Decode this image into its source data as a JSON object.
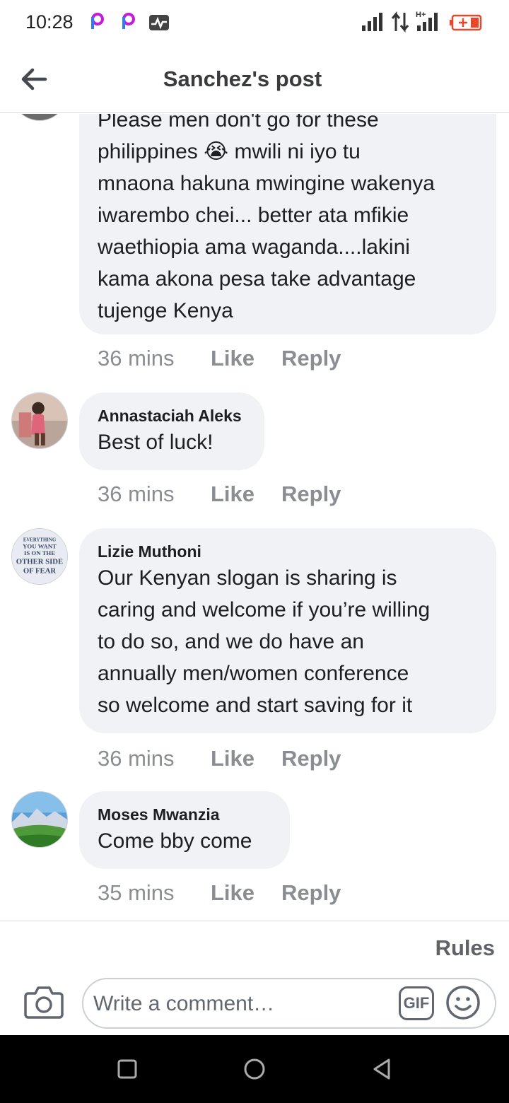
{
  "status_bar": {
    "time": "10:28",
    "icons": [
      "picsart-icon",
      "picsart-icon",
      "activity-icon",
      "signal-icon",
      "data-arrows-icon",
      "signal-hplus-icon",
      "battery-charging-icon"
    ],
    "network_label": "H+",
    "battery_color": "#e8472b"
  },
  "header": {
    "title": "Sanchez's post",
    "back_icon": "back-arrow-icon"
  },
  "comments": [
    {
      "name": "",
      "text": "Please men don't go for these\nphilippines 😭 mwili ni iyo tu\nmnaona hakuna mwingine wakenya\niwarembo chei... better ata mfikie\nwaethiopia ama waganda....lakini\nkama akona pesa take advantage\ntujenge Kenya",
      "time": "36 mins",
      "like": "Like",
      "reply": "Reply"
    },
    {
      "name": "Annastaciah Aleks",
      "text": "Best of luck!",
      "time": "36 mins",
      "like": "Like",
      "reply": "Reply"
    },
    {
      "name": "Lizie Muthoni",
      "text": "Our Kenyan slogan is sharing is\ncaring and welcome if you’re willing\nto do so,  and we do have an\nannually men/women conference\nso welcome and start saving for it",
      "time": "36 mins",
      "like": "Like",
      "reply": "Reply"
    },
    {
      "name": "Moses Mwanzia",
      "text": "Come bby come",
      "time": "35 mins",
      "like": "Like",
      "reply": "Reply"
    }
  ],
  "avatar_texts": {
    "lizie": [
      "EVERYTHING",
      "YOU WANT",
      "IS ON THE",
      "OTHER SIDE",
      "OF FEAR"
    ]
  },
  "compose": {
    "rules": "Rules",
    "placeholder": "Write a comment…",
    "gif": "GIF",
    "camera_icon": "camera-icon",
    "emoji_icon": "emoji-icon"
  },
  "nav": {
    "icons": [
      "recent-apps-icon",
      "home-icon",
      "back-icon"
    ]
  },
  "colors": {
    "bubble": "#f0f2f5",
    "meta_text": "#8a8d91",
    "nav_bar": "#000000",
    "picsart_accent": "#b51ee6"
  }
}
